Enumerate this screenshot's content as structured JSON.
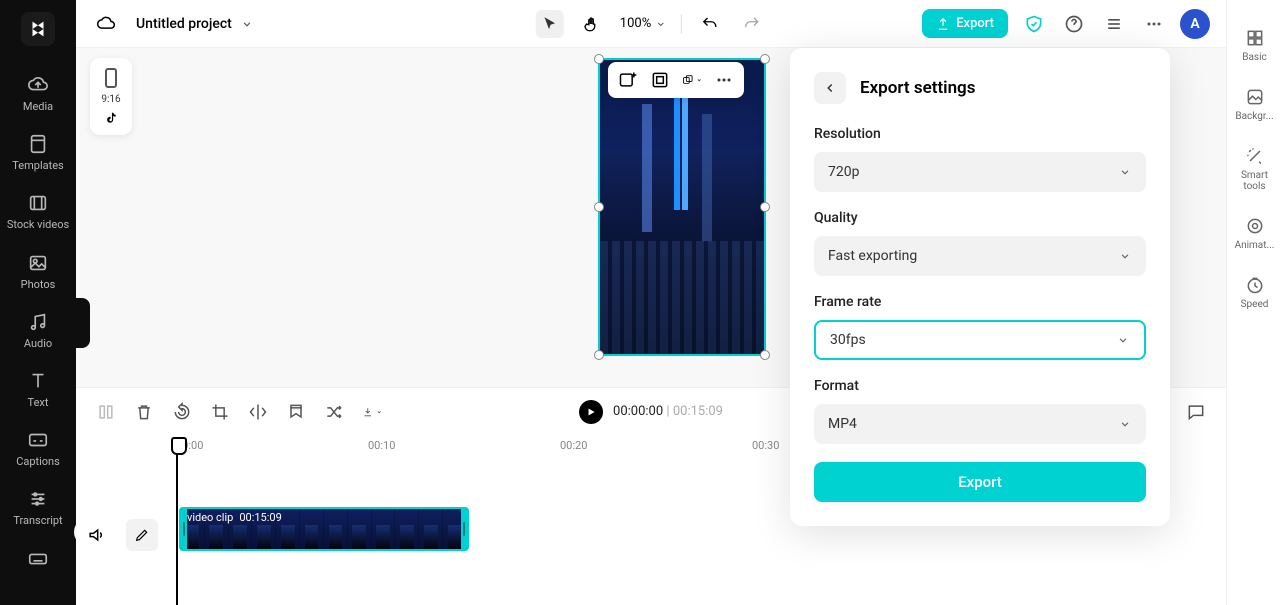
{
  "header": {
    "project_title": "Untitled project",
    "zoom": "100%",
    "export_label": "Export",
    "avatar_letter": "A"
  },
  "left_sidebar": {
    "items": [
      {
        "label": "Media"
      },
      {
        "label": "Templates"
      },
      {
        "label": "Stock videos"
      },
      {
        "label": "Photos"
      },
      {
        "label": "Audio"
      },
      {
        "label": "Text"
      },
      {
        "label": "Captions"
      },
      {
        "label": "Transcript"
      },
      {
        "label": ""
      }
    ]
  },
  "aspect_card": {
    "ratio": "9:16"
  },
  "playback": {
    "current": "00:00:00",
    "sep": "|",
    "duration": "00:15:09"
  },
  "ruler_ticks": [
    "00:00",
    "00:10",
    "00:20",
    "00:30"
  ],
  "clip": {
    "name": "video clip",
    "duration": "00:15:09"
  },
  "right_sidebar": {
    "items": [
      {
        "label": "Basic"
      },
      {
        "label": "Backgr..."
      },
      {
        "label": "Smart tools"
      },
      {
        "label": "Animat..."
      },
      {
        "label": "Speed"
      }
    ]
  },
  "export_panel": {
    "title": "Export settings",
    "resolution_label": "Resolution",
    "resolution_value": "720p",
    "quality_label": "Quality",
    "quality_value": "Fast exporting",
    "framerate_label": "Frame rate",
    "framerate_value": "30fps",
    "format_label": "Format",
    "format_value": "MP4",
    "export_button": "Export"
  }
}
